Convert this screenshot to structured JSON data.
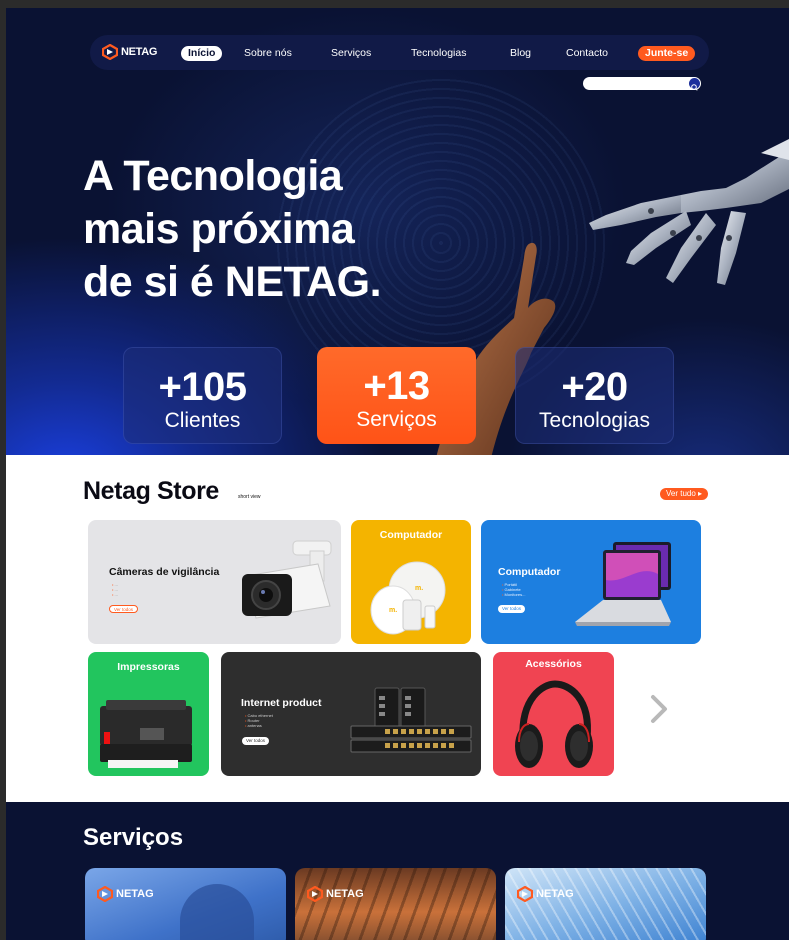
{
  "brand": {
    "name": "NETAG",
    "accent": "#ff5a1f",
    "navy": "#0a1233",
    "blue": "#1d4ed8"
  },
  "nav": {
    "items": [
      "Início",
      "Sobre nós",
      "Serviços",
      "Tecnologias",
      "Blog",
      "Contacto"
    ],
    "active": "Início",
    "cta": "Junte-se"
  },
  "search": {
    "placeholder": "",
    "icon": "search-icon"
  },
  "hero": {
    "headline": [
      "A Tecnologia",
      "mais próxima",
      "de si é NETAG."
    ]
  },
  "stats": [
    {
      "value": "+105",
      "label": "Clientes"
    },
    {
      "value": "+13",
      "label": "Serviços"
    },
    {
      "value": "+20",
      "label": "Tecnologias"
    }
  ],
  "store": {
    "title": "Netag Store",
    "subtitle": "short view",
    "see_all": "Ver tudo ▸",
    "cards": [
      {
        "title": "Câmeras de vigilância",
        "items": [
          "...",
          "...",
          "..."
        ],
        "button": "Ver todos",
        "color": "#e4e4e7"
      },
      {
        "title": "Computador",
        "color": "#f4b400"
      },
      {
        "title": "Computador",
        "items": [
          "Portátil",
          "Gabinete",
          "Monitores..."
        ],
        "button": "Ver todos",
        "color": "#1d7fe0"
      },
      {
        "title": "Impressoras",
        "color": "#22c55e"
      },
      {
        "title": "Internet product",
        "items": [
          "Cabo ethernet",
          "Router",
          "antenas"
        ],
        "button": "Ver todos",
        "color": "#2e2e2e"
      },
      {
        "title": "Acessórios",
        "color": "#f04452"
      }
    ],
    "next_icon": "chevron-right-icon"
  },
  "services": {
    "title": "Serviços",
    "cards": [
      {
        "brand": "NETAG"
      },
      {
        "brand": "NETAG"
      },
      {
        "brand": "NETAG"
      }
    ]
  }
}
